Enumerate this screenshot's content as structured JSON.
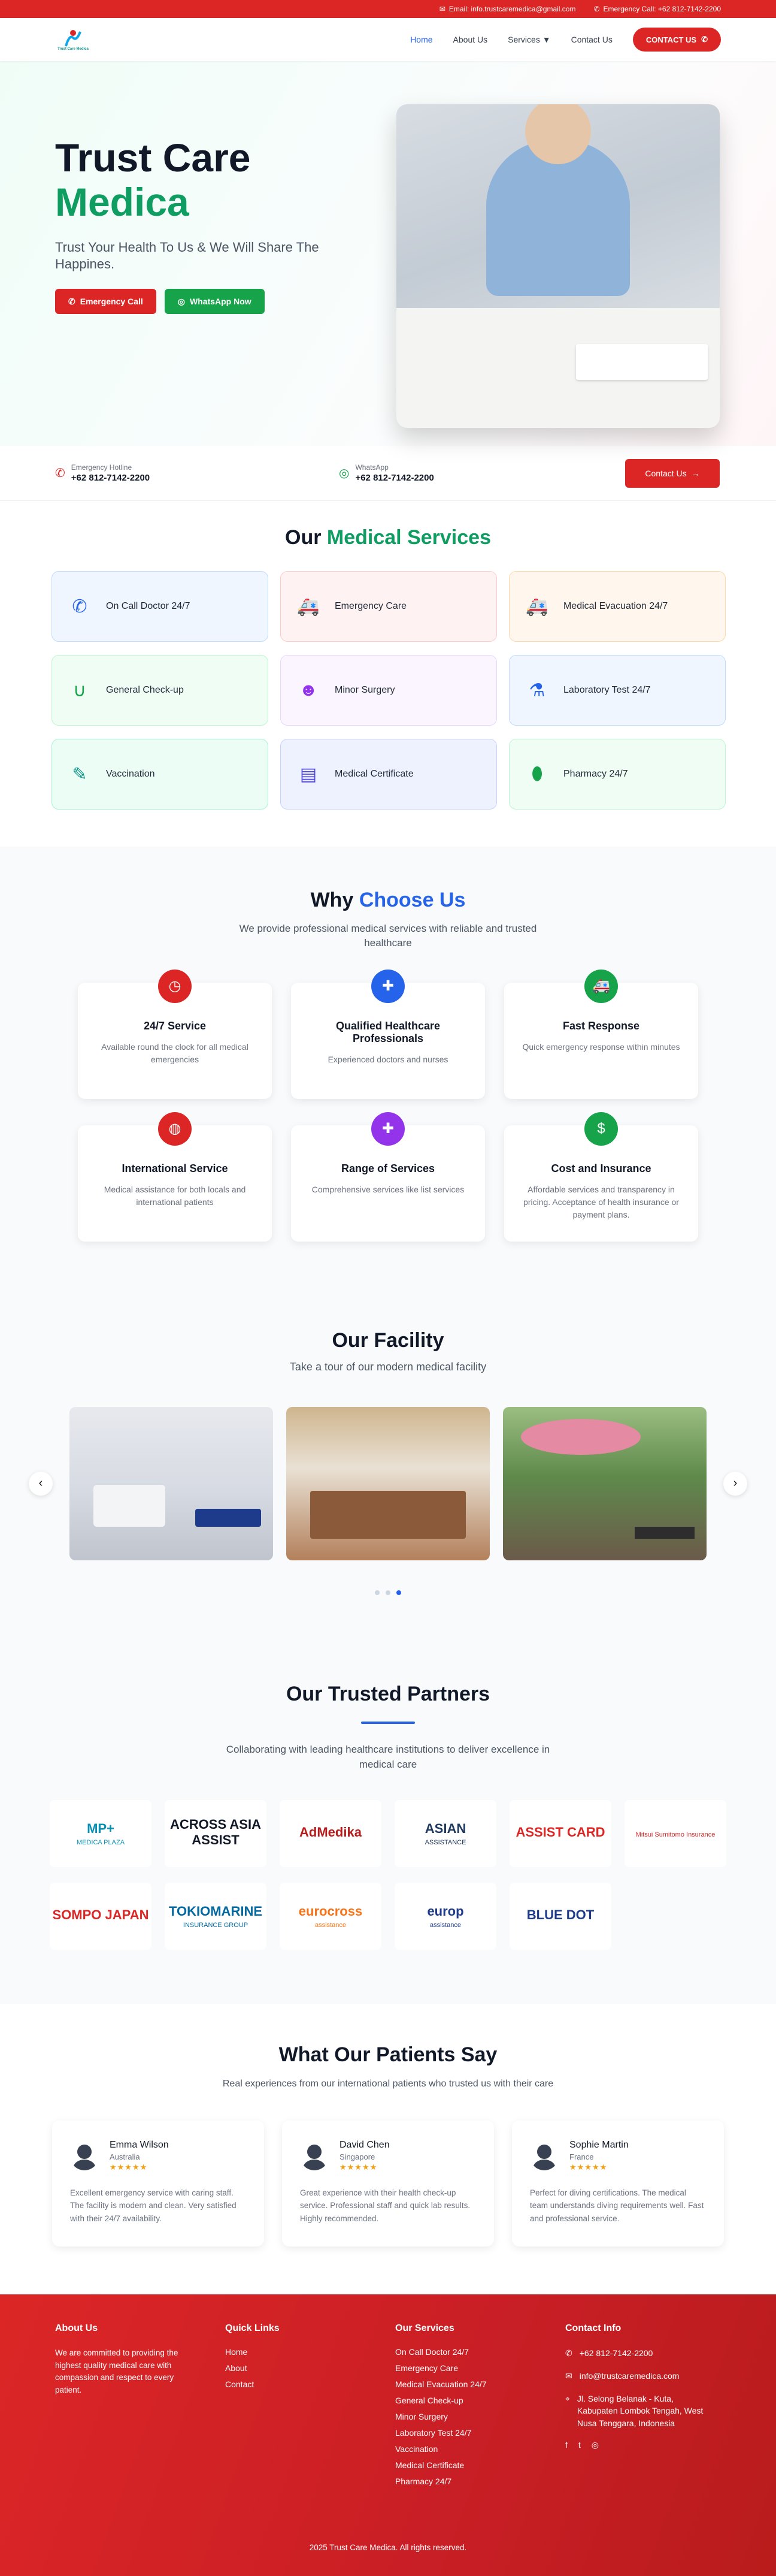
{
  "topbar": {
    "email": "Email: info.trustcaremedica@gmail.com",
    "phone": "Emergency Call: +62 812-7142-2200"
  },
  "header": {
    "logo_text": "Trust Care Medica",
    "nav": {
      "home": "Home",
      "about": "About Us",
      "services": "Services ▼",
      "contact": "Contact Us"
    },
    "cta": "CONTACT US"
  },
  "hero": {
    "title_line1": "Trust Care",
    "title_line2": "Medica",
    "subtitle": "Trust Your Health To Us & We Will Share The Happines.",
    "btn_emergency": "Emergency Call",
    "btn_whatsapp": "WhatsApp Now"
  },
  "strip": {
    "hotline_label": "Emergency Hotline",
    "hotline_value": "+62 812-7142-2200",
    "wa_label": "WhatsApp",
    "wa_value": "+62 812-7142-2200",
    "cta": "Contact Us"
  },
  "services": {
    "title_a": "Our",
    "title_b": "Medical Services",
    "items": [
      {
        "label": "On Call Doctor 24/7",
        "icon": "phone-icon",
        "color": "#2563eb"
      },
      {
        "label": "Emergency Care",
        "icon": "ambulance-icon",
        "color": "#dc2626"
      },
      {
        "label": "Medical Evacuation 24/7",
        "icon": "ambulance-icon",
        "color": "#ea580c"
      },
      {
        "label": "General Check-up",
        "icon": "stethoscope-icon",
        "color": "#16a34a"
      },
      {
        "label": "Minor Surgery",
        "icon": "surgeon-icon",
        "color": "#9333ea"
      },
      {
        "label": "Laboratory Test 24/7",
        "icon": "flask-icon",
        "color": "#2563eb"
      },
      {
        "label": "Vaccination",
        "icon": "syringe-icon",
        "color": "#0d9488"
      },
      {
        "label": "Medical Certificate",
        "icon": "id-card-icon",
        "color": "#4f46e5"
      },
      {
        "label": "Pharmacy 24/7",
        "icon": "pills-icon",
        "color": "#16a34a"
      }
    ]
  },
  "why": {
    "title_a": "Why",
    "title_b": "Choose Us",
    "subtitle": "We provide professional medical services with reliable and trusted healthcare",
    "items": [
      {
        "title": "24/7 Service",
        "text": "Available round the clock for all medical emergencies",
        "icon": "clock-icon",
        "color": "#dc2626"
      },
      {
        "title": "Qualified Healthcare Professionals",
        "text": "Experienced doctors and nurses",
        "icon": "doctor-icon",
        "color": "#2563eb"
      },
      {
        "title": "Fast Response",
        "text": "Quick emergency response within minutes",
        "icon": "ambulance-icon",
        "color": "#16a34a"
      },
      {
        "title": "International Service",
        "text": "Medical assistance for both locals and international patients",
        "icon": "globe-icon",
        "color": "#dc2626"
      },
      {
        "title": "Range of Services",
        "text": "Comprehensive services like list services",
        "icon": "kit-icon",
        "color": "#9333ea"
      },
      {
        "title": "Cost and Insurance",
        "text": "Affordable services and transparency in pricing. Acceptance of health insurance or payment plans.",
        "icon": "money-icon",
        "color": "#16a34a"
      }
    ]
  },
  "facility": {
    "title": "Our Facility",
    "subtitle": "Take a tour of our modern medical facility",
    "active_slide": 3,
    "slide_count": 3
  },
  "partners": {
    "title": "Our Trusted Partners",
    "subtitle": "Collaborating with leading healthcare institutions to deliver excellence in medical care",
    "logos": [
      {
        "name": "MP+",
        "sub": "MEDICA PLAZA",
        "color": "#0891b2"
      },
      {
        "name": "ACROSS ASIA ASSIST",
        "sub": "",
        "color": "#111827"
      },
      {
        "name": "AdMedika",
        "sub": "",
        "color": "#b91c1c"
      },
      {
        "name": "ASIAN",
        "sub": "ASSISTANCE",
        "color": "#1e3a5f"
      },
      {
        "name": "ASSIST CARD",
        "sub": "",
        "color": "#dc2626"
      },
      {
        "name": "",
        "sub": "Mitsui Sumitomo Insurance",
        "color": "#dc2626"
      },
      {
        "name": "SOMPO JAPAN",
        "sub": "",
        "color": "#dc2626"
      },
      {
        "name": "TOKIOMARINE",
        "sub": "INSURANCE GROUP",
        "color": "#0369a1"
      },
      {
        "name": "eurocross",
        "sub": "assistance",
        "color": "#f97316"
      },
      {
        "name": "europ",
        "sub": "assistance",
        "color": "#1e3a8a"
      },
      {
        "name": "BLUE DOT",
        "sub": "",
        "color": "#1e3a8a"
      }
    ]
  },
  "reviews": {
    "title": "What Our Patients Say",
    "subtitle": "Real experiences from our international patients who trusted us with their care",
    "items": [
      {
        "name": "Emma Wilson",
        "country": "Australia",
        "stars": "★★★★★",
        "text": "Excellent emergency service with caring staff. The facility is modern and clean. Very satisfied with their 24/7 availability."
      },
      {
        "name": "David Chen",
        "country": "Singapore",
        "stars": "★★★★★",
        "text": "Great experience with their health check-up service. Professional staff and quick lab results. Highly recommended."
      },
      {
        "name": "Sophie Martin",
        "country": "France",
        "stars": "★★★★★",
        "text": "Perfect for diving certifications. The medical team understands diving requirements well. Fast and professional service."
      }
    ]
  },
  "footer": {
    "about_title": "About Us",
    "about_text": "We are committed to providing the highest quality medical care with compassion and respect to every patient.",
    "links_title": "Quick Links",
    "links": [
      "Home",
      "About",
      "Contact"
    ],
    "services_title": "Our Services",
    "services": [
      "On Call Doctor 24/7",
      "Emergency Care",
      "Medical Evacuation 24/7",
      "General Check-up",
      "Minor Surgery",
      "Laboratory Test 24/7",
      "Vaccination",
      "Medical Certificate",
      "Pharmacy 24/7"
    ],
    "contact_title": "Contact Info",
    "phone": "+62 812-7142-2200",
    "email": "info@trustcaremedica.com",
    "address": "Jl. Selong Belanak - Kuta, Kabupaten Lombok Tengah, West Nusa Tenggara, Indonesia",
    "copyright": "2025 Trust Care Medica. All rights reserved."
  }
}
